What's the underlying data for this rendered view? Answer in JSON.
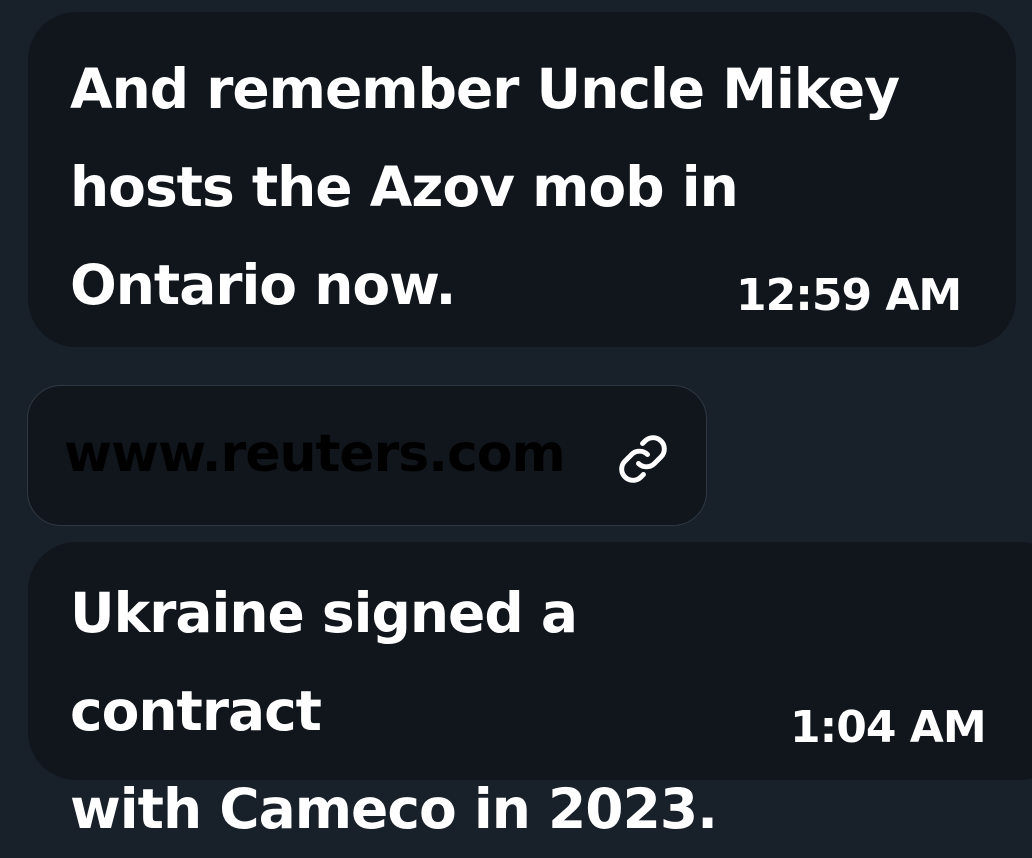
{
  "conversation": {
    "messages": [
      {
        "text": "And remember Uncle Mikey\nhosts the Azov mob in\nOntario now.",
        "time": "12:59 AM"
      },
      {
        "link": {
          "domain": "www.reuters.com",
          "icon": "link-icon"
        }
      },
      {
        "text": "Ukraine signed a contract\nwith Cameco in 2023.",
        "time": "1:04 AM"
      }
    ]
  },
  "colors": {
    "background": "#18202a",
    "bubble": "#11161d",
    "text": "#ffffff",
    "link_border": "#2f3842"
  }
}
